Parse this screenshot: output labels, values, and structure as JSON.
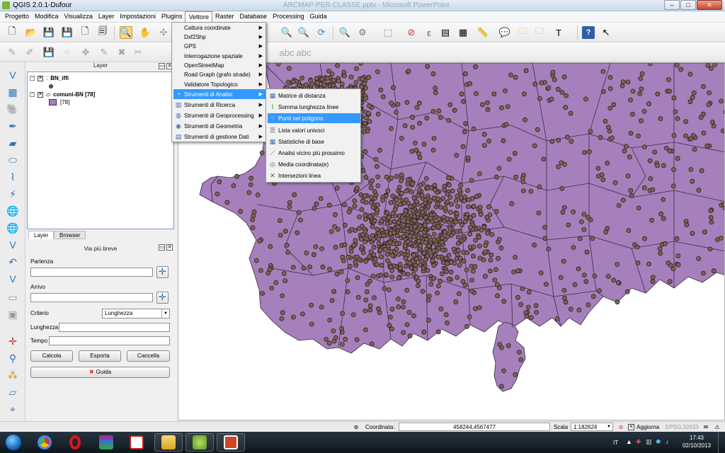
{
  "window": {
    "title": "QGIS 2.0.1-Dufour",
    "background_title": "ARCMAP-PER-CLASSE.pptx - Microsoft PowerPoint",
    "minimize": "–",
    "maximize": "□",
    "close": "✕"
  },
  "menubar": [
    "Progetto",
    "Modifica",
    "Visualizza",
    "Layer",
    "Impostazioni",
    "Plugins",
    "Vettore",
    "Raster",
    "Database",
    "Processing",
    "Guida"
  ],
  "vettore_menu": {
    "items": [
      {
        "label": "Cattura coordinate",
        "submenu": true
      },
      {
        "label": "Dxf2Shp",
        "submenu": true
      },
      {
        "label": "GPS",
        "submenu": true
      },
      {
        "label": "Interrogazione spaziale",
        "submenu": true
      },
      {
        "label": "OpenStreetMap",
        "submenu": true
      },
      {
        "label": "Road Graph (grafo strade)",
        "submenu": true
      },
      {
        "label": "Validatore Topologico",
        "submenu": true
      },
      {
        "label": "Strumenti di Analisi",
        "submenu": true,
        "highlighted": true
      },
      {
        "label": "Strumenti di Ricerca",
        "submenu": true
      },
      {
        "label": "Strumenti di Geoprocessing",
        "submenu": true
      },
      {
        "label": "Strumenti di Geometria",
        "submenu": true
      },
      {
        "label": "Strumenti di gestione Dati",
        "submenu": true
      }
    ]
  },
  "analisi_submenu": {
    "items": [
      {
        "label": "Matrice di distanza"
      },
      {
        "label": "Somma lunghezza linee"
      },
      {
        "label": "Punti nel poligono",
        "highlighted": true
      },
      {
        "label": "Lista valori univoci"
      },
      {
        "label": "Statistiche di base"
      },
      {
        "label": "Analisi vicino più prossimo"
      },
      {
        "label": "Media coordinata(e)"
      },
      {
        "label": "Intersezioni linea"
      }
    ]
  },
  "layers_panel": {
    "title": "Layer",
    "layers": [
      {
        "name": "BN_iffi",
        "checked": true,
        "symbol": "point",
        "symbol_color": "#7a5a52"
      },
      {
        "name": "comuni-BN [78]",
        "checked": true,
        "symbol": "polygon",
        "symbol_color": "#a77fc0",
        "legend_label": "[78]"
      }
    ],
    "tabs": [
      "Layer",
      "Browser"
    ]
  },
  "route_panel": {
    "title": "Via più breve",
    "start_label": "Partenza",
    "start_value": "",
    "end_label": "Arrivo",
    "end_value": "",
    "criterion_label": "Criterio",
    "criterion_value": "Lunghezza",
    "length_label": "Lunghezza",
    "length_value": "",
    "time_label": "Tempo",
    "time_value": "",
    "buttons": {
      "calc": "Calcola",
      "export": "Esporta",
      "cancel": "Cancella",
      "help": "Guida"
    }
  },
  "map": {
    "polygon_fill": "#a680bc",
    "polygon_stroke": "#3a2a44",
    "point_fill": "#7d6258",
    "point_stroke": "#2b1f1a"
  },
  "statusbar": {
    "coord_label": "Coordinata:",
    "coord_value": "458244,4567477",
    "scale_label": "Scala",
    "scale_value": "1:182624",
    "refresh_label": "Aggiorna",
    "crs": "EPSG:32633"
  },
  "taskbar": {
    "language": "IT",
    "time": "17:43",
    "date": "02/10/2013"
  }
}
